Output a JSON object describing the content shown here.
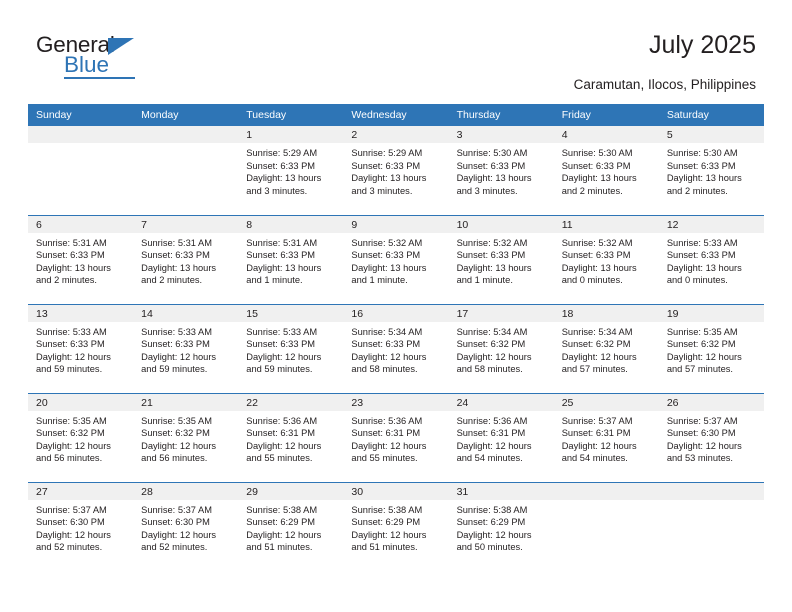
{
  "brand": {
    "name_top": "General",
    "name_bottom": "Blue",
    "triangle_icon": "blue-triangle-icon",
    "accent_color": "#2E74B5"
  },
  "header": {
    "title": "July 2025",
    "subtitle": "Caramutan, Ilocos, Philippines"
  },
  "theme": {
    "header_row_bg": "#2E75B6",
    "header_row_text": "#FFFFFF",
    "date_band_bg": "#F0F0F0",
    "row_divider": "#2E75B6",
    "body_text": "#231F20"
  },
  "calendar": {
    "month": "July",
    "year": "2025",
    "weekday_headers": [
      "Sunday",
      "Monday",
      "Tuesday",
      "Wednesday",
      "Thursday",
      "Friday",
      "Saturday"
    ],
    "weeks": [
      [
        {
          "date": "",
          "sunrise": "",
          "sunset": "",
          "daylight_line1": "",
          "daylight_line2": ""
        },
        {
          "date": "",
          "sunrise": "",
          "sunset": "",
          "daylight_line1": "",
          "daylight_line2": ""
        },
        {
          "date": "1",
          "sunrise": "Sunrise: 5:29 AM",
          "sunset": "Sunset: 6:33 PM",
          "daylight_line1": "Daylight: 13 hours",
          "daylight_line2": "and 3 minutes."
        },
        {
          "date": "2",
          "sunrise": "Sunrise: 5:29 AM",
          "sunset": "Sunset: 6:33 PM",
          "daylight_line1": "Daylight: 13 hours",
          "daylight_line2": "and 3 minutes."
        },
        {
          "date": "3",
          "sunrise": "Sunrise: 5:30 AM",
          "sunset": "Sunset: 6:33 PM",
          "daylight_line1": "Daylight: 13 hours",
          "daylight_line2": "and 3 minutes."
        },
        {
          "date": "4",
          "sunrise": "Sunrise: 5:30 AM",
          "sunset": "Sunset: 6:33 PM",
          "daylight_line1": "Daylight: 13 hours",
          "daylight_line2": "and 2 minutes."
        },
        {
          "date": "5",
          "sunrise": "Sunrise: 5:30 AM",
          "sunset": "Sunset: 6:33 PM",
          "daylight_line1": "Daylight: 13 hours",
          "daylight_line2": "and 2 minutes."
        }
      ],
      [
        {
          "date": "6",
          "sunrise": "Sunrise: 5:31 AM",
          "sunset": "Sunset: 6:33 PM",
          "daylight_line1": "Daylight: 13 hours",
          "daylight_line2": "and 2 minutes."
        },
        {
          "date": "7",
          "sunrise": "Sunrise: 5:31 AM",
          "sunset": "Sunset: 6:33 PM",
          "daylight_line1": "Daylight: 13 hours",
          "daylight_line2": "and 2 minutes."
        },
        {
          "date": "8",
          "sunrise": "Sunrise: 5:31 AM",
          "sunset": "Sunset: 6:33 PM",
          "daylight_line1": "Daylight: 13 hours",
          "daylight_line2": "and 1 minute."
        },
        {
          "date": "9",
          "sunrise": "Sunrise: 5:32 AM",
          "sunset": "Sunset: 6:33 PM",
          "daylight_line1": "Daylight: 13 hours",
          "daylight_line2": "and 1 minute."
        },
        {
          "date": "10",
          "sunrise": "Sunrise: 5:32 AM",
          "sunset": "Sunset: 6:33 PM",
          "daylight_line1": "Daylight: 13 hours",
          "daylight_line2": "and 1 minute."
        },
        {
          "date": "11",
          "sunrise": "Sunrise: 5:32 AM",
          "sunset": "Sunset: 6:33 PM",
          "daylight_line1": "Daylight: 13 hours",
          "daylight_line2": "and 0 minutes."
        },
        {
          "date": "12",
          "sunrise": "Sunrise: 5:33 AM",
          "sunset": "Sunset: 6:33 PM",
          "daylight_line1": "Daylight: 13 hours",
          "daylight_line2": "and 0 minutes."
        }
      ],
      [
        {
          "date": "13",
          "sunrise": "Sunrise: 5:33 AM",
          "sunset": "Sunset: 6:33 PM",
          "daylight_line1": "Daylight: 12 hours",
          "daylight_line2": "and 59 minutes."
        },
        {
          "date": "14",
          "sunrise": "Sunrise: 5:33 AM",
          "sunset": "Sunset: 6:33 PM",
          "daylight_line1": "Daylight: 12 hours",
          "daylight_line2": "and 59 minutes."
        },
        {
          "date": "15",
          "sunrise": "Sunrise: 5:33 AM",
          "sunset": "Sunset: 6:33 PM",
          "daylight_line1": "Daylight: 12 hours",
          "daylight_line2": "and 59 minutes."
        },
        {
          "date": "16",
          "sunrise": "Sunrise: 5:34 AM",
          "sunset": "Sunset: 6:33 PM",
          "daylight_line1": "Daylight: 12 hours",
          "daylight_line2": "and 58 minutes."
        },
        {
          "date": "17",
          "sunrise": "Sunrise: 5:34 AM",
          "sunset": "Sunset: 6:32 PM",
          "daylight_line1": "Daylight: 12 hours",
          "daylight_line2": "and 58 minutes."
        },
        {
          "date": "18",
          "sunrise": "Sunrise: 5:34 AM",
          "sunset": "Sunset: 6:32 PM",
          "daylight_line1": "Daylight: 12 hours",
          "daylight_line2": "and 57 minutes."
        },
        {
          "date": "19",
          "sunrise": "Sunrise: 5:35 AM",
          "sunset": "Sunset: 6:32 PM",
          "daylight_line1": "Daylight: 12 hours",
          "daylight_line2": "and 57 minutes."
        }
      ],
      [
        {
          "date": "20",
          "sunrise": "Sunrise: 5:35 AM",
          "sunset": "Sunset: 6:32 PM",
          "daylight_line1": "Daylight: 12 hours",
          "daylight_line2": "and 56 minutes."
        },
        {
          "date": "21",
          "sunrise": "Sunrise: 5:35 AM",
          "sunset": "Sunset: 6:32 PM",
          "daylight_line1": "Daylight: 12 hours",
          "daylight_line2": "and 56 minutes."
        },
        {
          "date": "22",
          "sunrise": "Sunrise: 5:36 AM",
          "sunset": "Sunset: 6:31 PM",
          "daylight_line1": "Daylight: 12 hours",
          "daylight_line2": "and 55 minutes."
        },
        {
          "date": "23",
          "sunrise": "Sunrise: 5:36 AM",
          "sunset": "Sunset: 6:31 PM",
          "daylight_line1": "Daylight: 12 hours",
          "daylight_line2": "and 55 minutes."
        },
        {
          "date": "24",
          "sunrise": "Sunrise: 5:36 AM",
          "sunset": "Sunset: 6:31 PM",
          "daylight_line1": "Daylight: 12 hours",
          "daylight_line2": "and 54 minutes."
        },
        {
          "date": "25",
          "sunrise": "Sunrise: 5:37 AM",
          "sunset": "Sunset: 6:31 PM",
          "daylight_line1": "Daylight: 12 hours",
          "daylight_line2": "and 54 minutes."
        },
        {
          "date": "26",
          "sunrise": "Sunrise: 5:37 AM",
          "sunset": "Sunset: 6:30 PM",
          "daylight_line1": "Daylight: 12 hours",
          "daylight_line2": "and 53 minutes."
        }
      ],
      [
        {
          "date": "27",
          "sunrise": "Sunrise: 5:37 AM",
          "sunset": "Sunset: 6:30 PM",
          "daylight_line1": "Daylight: 12 hours",
          "daylight_line2": "and 52 minutes."
        },
        {
          "date": "28",
          "sunrise": "Sunrise: 5:37 AM",
          "sunset": "Sunset: 6:30 PM",
          "daylight_line1": "Daylight: 12 hours",
          "daylight_line2": "and 52 minutes."
        },
        {
          "date": "29",
          "sunrise": "Sunrise: 5:38 AM",
          "sunset": "Sunset: 6:29 PM",
          "daylight_line1": "Daylight: 12 hours",
          "daylight_line2": "and 51 minutes."
        },
        {
          "date": "30",
          "sunrise": "Sunrise: 5:38 AM",
          "sunset": "Sunset: 6:29 PM",
          "daylight_line1": "Daylight: 12 hours",
          "daylight_line2": "and 51 minutes."
        },
        {
          "date": "31",
          "sunrise": "Sunrise: 5:38 AM",
          "sunset": "Sunset: 6:29 PM",
          "daylight_line1": "Daylight: 12 hours",
          "daylight_line2": "and 50 minutes."
        },
        {
          "date": "",
          "sunrise": "",
          "sunset": "",
          "daylight_line1": "",
          "daylight_line2": ""
        },
        {
          "date": "",
          "sunrise": "",
          "sunset": "",
          "daylight_line1": "",
          "daylight_line2": ""
        }
      ]
    ]
  }
}
